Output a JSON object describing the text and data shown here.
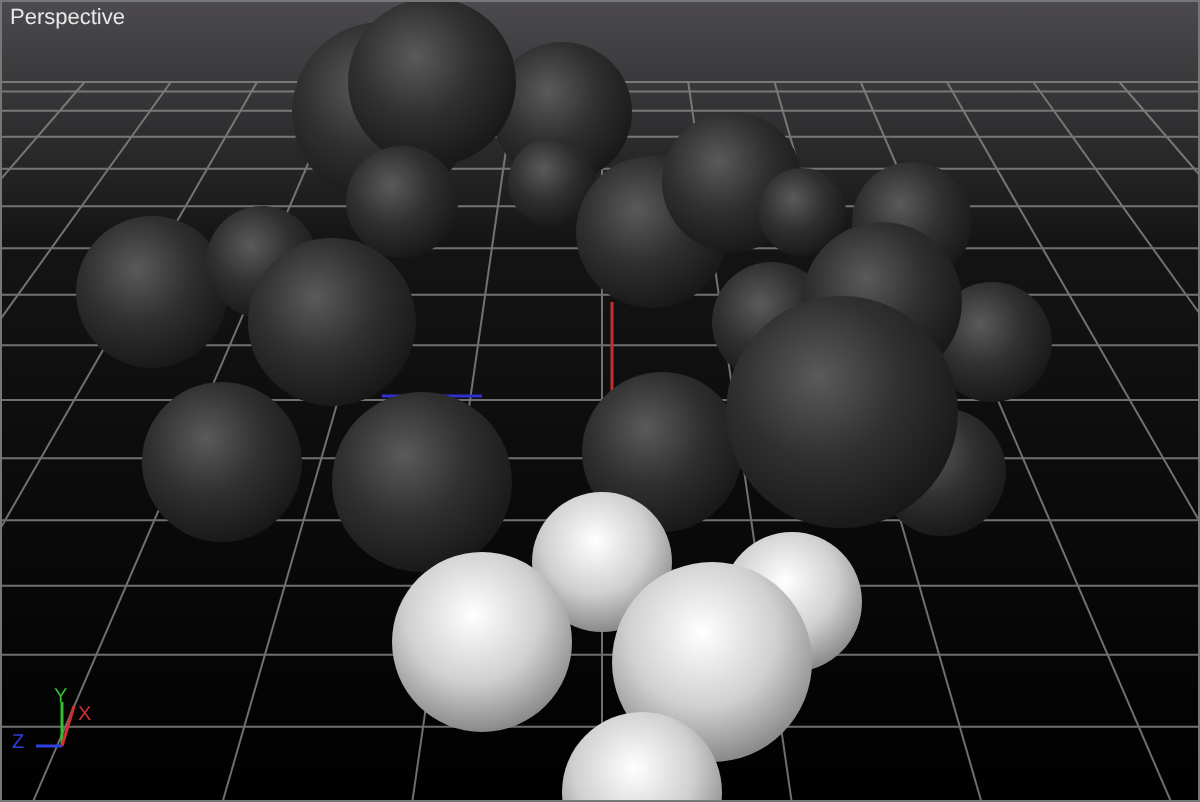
{
  "viewport": {
    "label": "Perspective"
  },
  "axis_gizmo": {
    "x_label": "X",
    "y_label": "Y",
    "z_label": "Z"
  }
}
